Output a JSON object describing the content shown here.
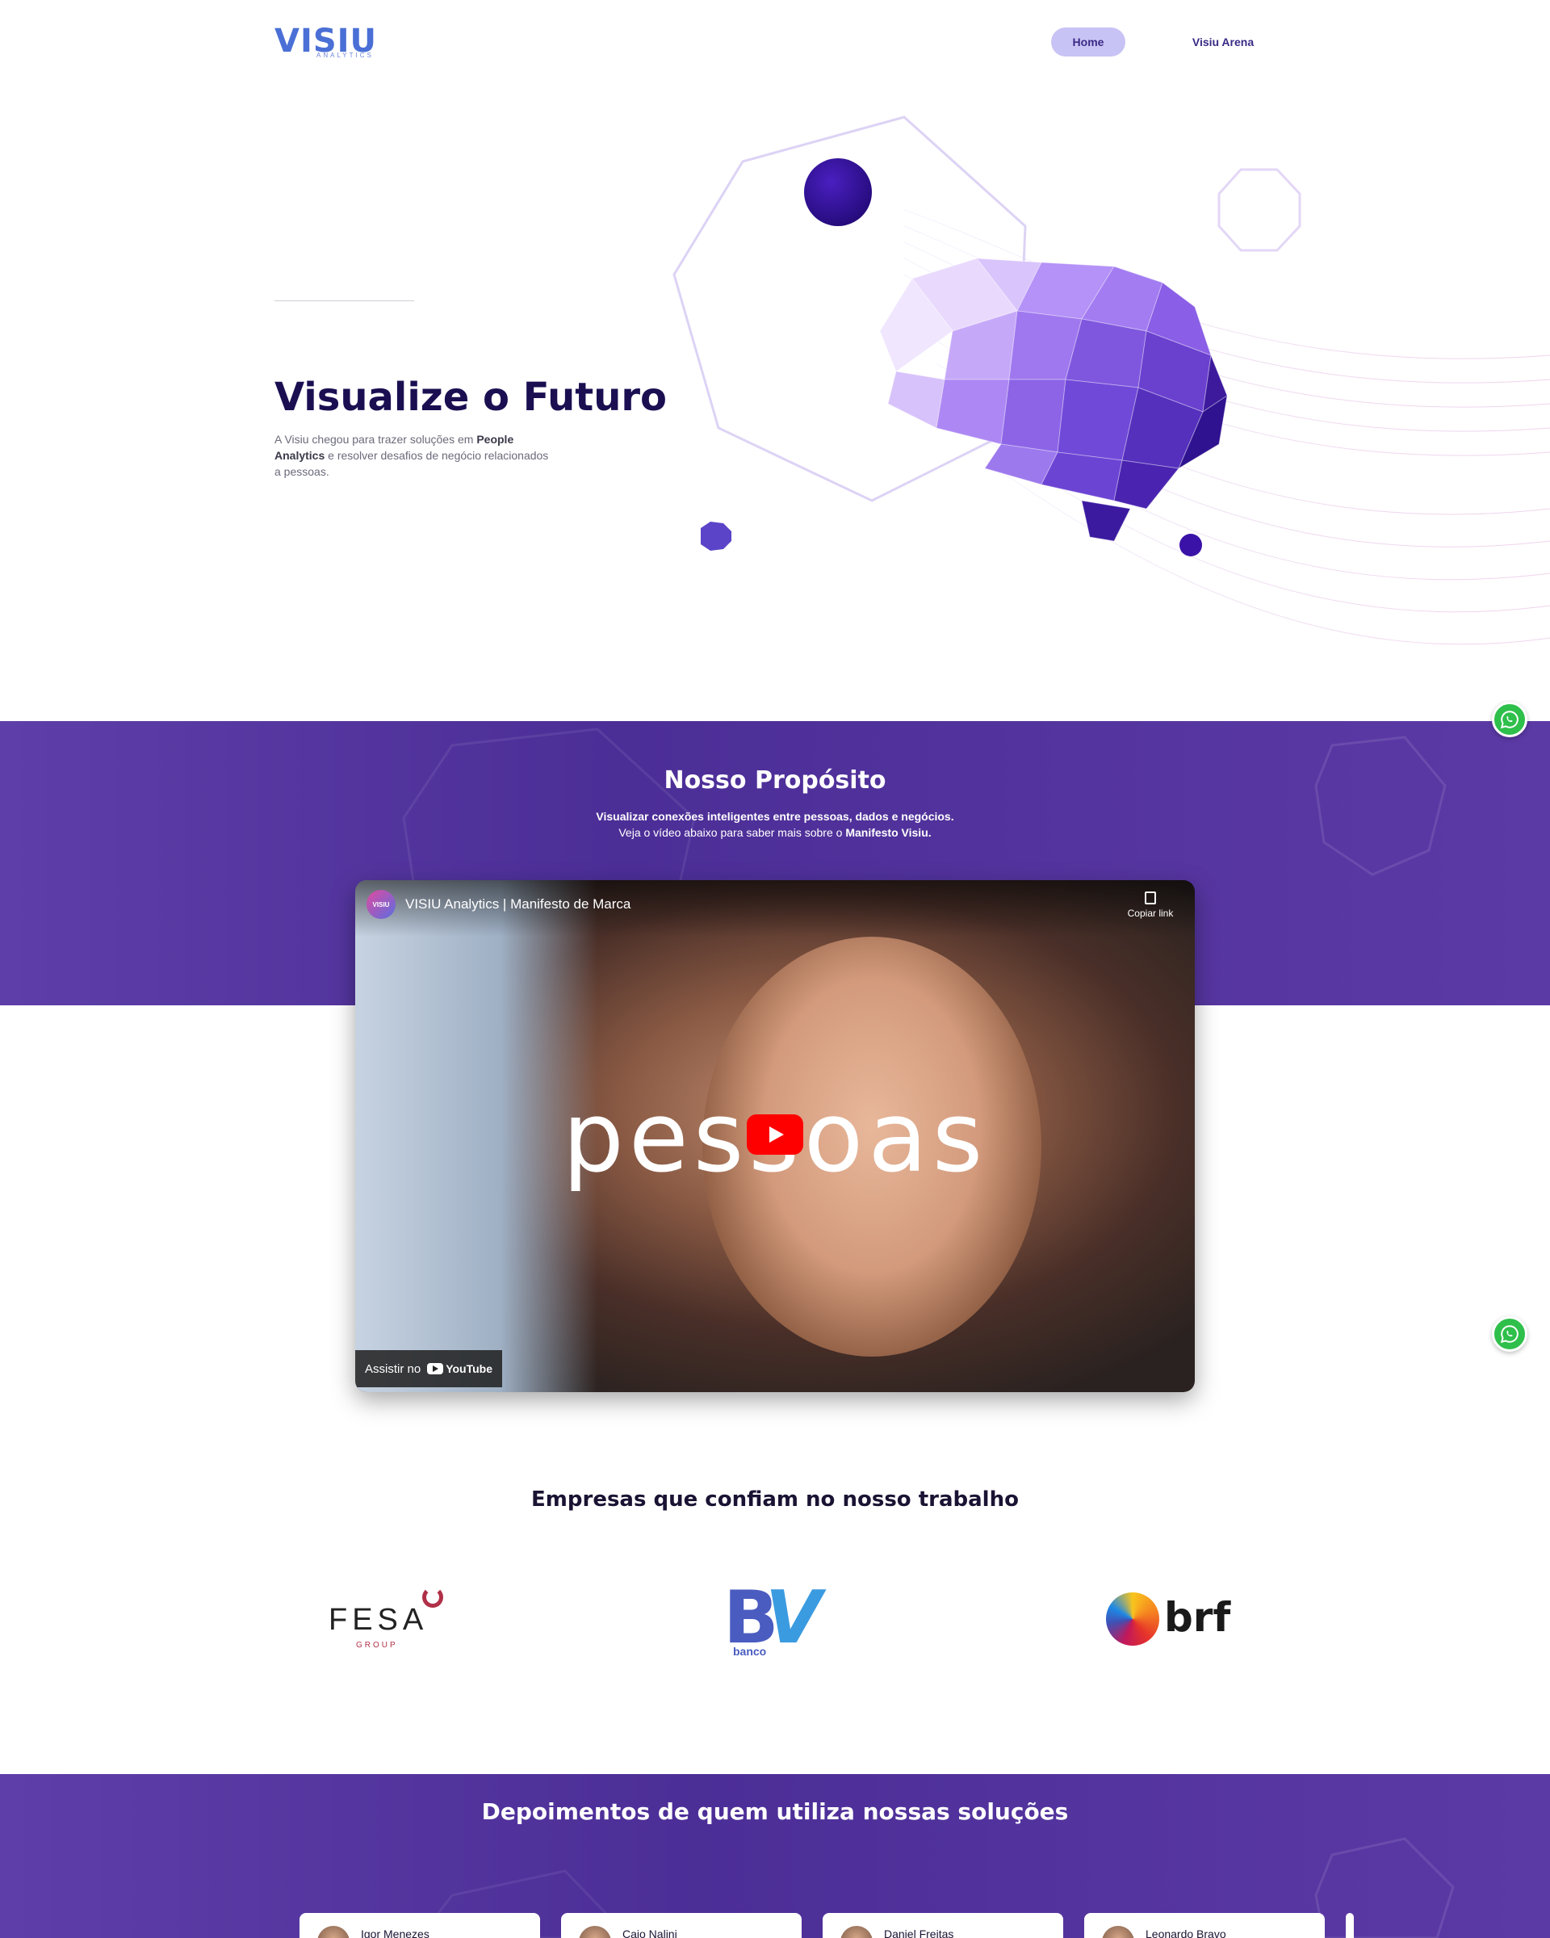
{
  "header": {
    "logo_main": "VISIU",
    "logo_sub": "ANALYTICS",
    "nav": [
      {
        "label": "Home",
        "active": true
      },
      {
        "label": "Visiu Arena",
        "active": false
      }
    ]
  },
  "hero": {
    "title": "Visualize o Futuro",
    "text_before": "A Visiu chegou para trazer soluções em ",
    "text_bold": "People Analytics",
    "text_after": " e resolver desafios de negócio relacionados a pessoas."
  },
  "purpose": {
    "title": "Nosso Propósito",
    "subtitle": "Visualizar conexões inteligentes entre pessoas, dados e negócios.",
    "line_before": "Veja o vídeo abaixo para saber mais sobre o ",
    "line_bold": "Manifesto Visiu."
  },
  "video": {
    "channel_badge": "VISIU",
    "title": "VISIU Analytics | Manifesto de Marca",
    "copy_link": "Copiar link",
    "overlay_word": "pessoas",
    "watch_on": "Assistir no",
    "youtube": "YouTube"
  },
  "companies": {
    "title": "Empresas que confiam no nosso trabalho",
    "logos": [
      {
        "name": "FESA",
        "sub": "GROUP"
      },
      {
        "name": "BV",
        "sub": "banco"
      },
      {
        "name": "brf"
      }
    ]
  },
  "testimonials": {
    "title": "Depoimentos de quem utiliza nossas soluções",
    "cards": [
      {
        "name": "Igor Menezes"
      },
      {
        "name": "Caio Nalini"
      },
      {
        "name": "Daniel Freitas"
      },
      {
        "name": "Leonardo Bravo"
      }
    ]
  },
  "colors": {
    "brand_purple": "#4c2e97",
    "heading_navy": "#1b0f52",
    "nav_active_bg": "#c8c3f5",
    "whatsapp": "#2fbf4b"
  },
  "icons": [
    "whatsapp-icon",
    "copy-link-icon",
    "play-icon",
    "youtube-logo-icon"
  ]
}
